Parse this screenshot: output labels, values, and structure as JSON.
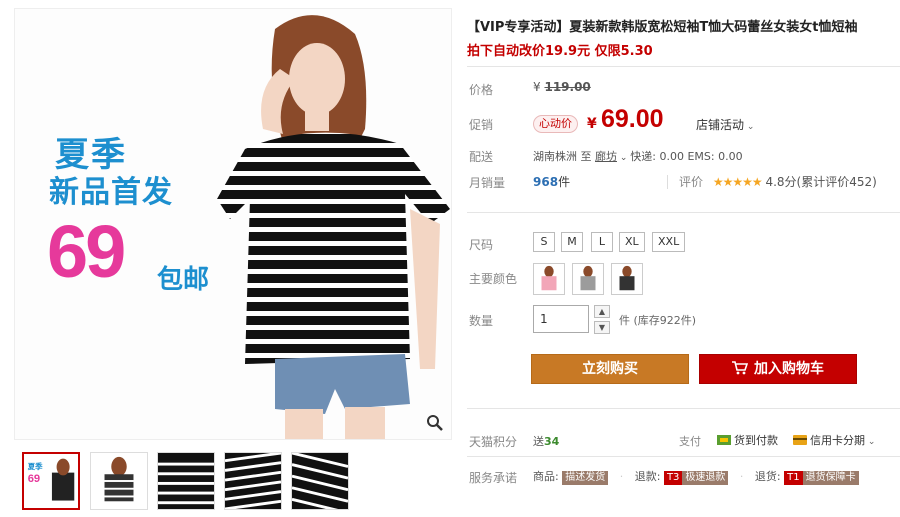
{
  "gallery": {
    "promo_line1": "夏季",
    "promo_line2": "新品首发",
    "promo_price": "69",
    "promo_shipping": "包邮",
    "zoom_icon": "magnifier-icon",
    "thumbnails": [
      "thumb-1",
      "thumb-2",
      "thumb-3",
      "thumb-4",
      "thumb-5"
    ]
  },
  "product": {
    "title": "【VIP专享活动】夏装新款韩版宽松短袖T恤大码蕾丝女装女t恤短袖",
    "subtitle": "拍下自动改价19.9元 仅限5.30"
  },
  "price": {
    "label": "价格",
    "currency": "¥",
    "original": "119.00"
  },
  "promo": {
    "label": "促销",
    "badge": "心动价",
    "currency": "¥",
    "price": "69.00",
    "store_activity": "店铺活动"
  },
  "shipping": {
    "label": "配送",
    "from": "湖南株洲",
    "to_word": "至",
    "to": "廊坊",
    "fees": "快递: 0.00 EMS: 0.00"
  },
  "sales": {
    "label": "月销量",
    "count": "968",
    "unit": "件",
    "review_label": "评价",
    "stars": "★★★★★",
    "score": "4.8分(累计评价452)"
  },
  "sizes": {
    "label": "尺码",
    "options": [
      "S",
      "M",
      "L",
      "XL",
      "XXL"
    ]
  },
  "colors": {
    "label": "主要颜色",
    "swatches": [
      "pink",
      "grey",
      "black"
    ]
  },
  "quantity": {
    "label": "数量",
    "value": "1",
    "stock": "件 (库存922件)"
  },
  "actions": {
    "buy_now": "立刻购买",
    "add_to_cart": "加入购物车"
  },
  "points": {
    "label": "天猫积分",
    "value_prefix": "送",
    "value": "34"
  },
  "payment": {
    "label": "支付",
    "cod": "货到付款",
    "credit": "信用卡分期"
  },
  "services": {
    "label": "服务承诺",
    "goods_label": "商品:",
    "goods_tag": "描述发货",
    "refund_label": "退款:",
    "refund_code": "T3",
    "refund_tag": "极速退款",
    "return_label": "退货:",
    "return_code": "T1",
    "return_tag": "退货保障卡"
  },
  "colors_theme": {
    "tmall_red": "#c40000",
    "buy_orange": "#c87925",
    "promo_pink": "#e6399b",
    "promo_blue": "#1d8fcf"
  }
}
